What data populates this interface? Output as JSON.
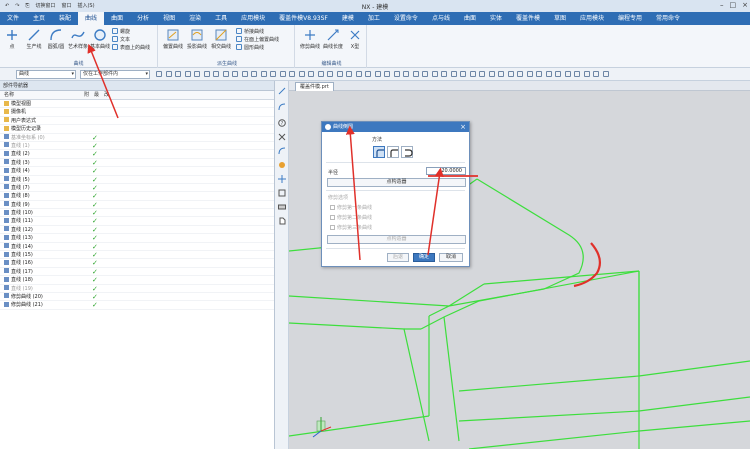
{
  "titlebar": {
    "quick_access": [
      "↶",
      "↷",
      "⎘",
      "切换窗口",
      "窗口",
      "插入(S)"
    ],
    "title": "NX - 建模"
  },
  "menu_tabs": [
    "文件",
    "主页",
    "装配",
    "曲线",
    "曲面",
    "分析",
    "视图",
    "渲染",
    "工具",
    "应用模块",
    "覆盖件模V8.93SF",
    "建模",
    "加工",
    "设置命令",
    "点与线",
    "曲面",
    "实体",
    "覆盖件模",
    "草图",
    "应用模块",
    "编程专用",
    "常用命令"
  ],
  "active_tab_index": 3,
  "ribbon": {
    "big_buttons": [
      "点",
      "生产线",
      "圆弧/圆",
      "艺术样条",
      "基本曲线"
    ],
    "small_buttons": [
      "螺旋",
      "文本",
      "表面上的曲线"
    ],
    "group_curve": "曲线",
    "derived_buttons": [
      "偏置曲线",
      "投影曲线",
      "相交曲线"
    ],
    "derived_small": [
      "桥接曲线",
      "在面上偏置曲线",
      "圆形曲线"
    ],
    "group_derived": "派生曲线",
    "edit_buttons": [
      "修剪曲线",
      "曲线长度",
      "X型"
    ],
    "group_edit": "编辑曲线"
  },
  "toolbar": {
    "combo1": "曲线",
    "combo2": "仅在工作部件内"
  },
  "navigator": {
    "header": "部件导航器",
    "columns": [
      "名称",
      "附",
      "最",
      "改"
    ],
    "rows": [
      {
        "label": "模型视图",
        "check": false,
        "grey": false
      },
      {
        "label": "摄像机",
        "check": false,
        "grey": false
      },
      {
        "label": "用户表达式",
        "check": false,
        "grey": false
      },
      {
        "label": "模型历史记录",
        "check": false,
        "grey": false
      },
      {
        "label": "基准坐标系 (0)",
        "check": true,
        "grey": true
      },
      {
        "label": "直线 (1)",
        "check": true,
        "grey": true
      },
      {
        "label": "直线 (2)",
        "check": true,
        "grey": false
      },
      {
        "label": "直线 (3)",
        "check": true,
        "grey": false
      },
      {
        "label": "直线 (4)",
        "check": true,
        "grey": false
      },
      {
        "label": "直线 (5)",
        "check": true,
        "grey": false
      },
      {
        "label": "直线 (7)",
        "check": true,
        "grey": false
      },
      {
        "label": "直线 (8)",
        "check": true,
        "grey": false
      },
      {
        "label": "直线 (9)",
        "check": true,
        "grey": false
      },
      {
        "label": "直线 (10)",
        "check": true,
        "grey": false
      },
      {
        "label": "直线 (11)",
        "check": true,
        "grey": false
      },
      {
        "label": "直线 (12)",
        "check": true,
        "grey": false
      },
      {
        "label": "直线 (13)",
        "check": true,
        "grey": false
      },
      {
        "label": "直线 (14)",
        "check": true,
        "grey": false
      },
      {
        "label": "直线 (15)",
        "check": true,
        "grey": false
      },
      {
        "label": "直线 (16)",
        "check": true,
        "grey": false
      },
      {
        "label": "直线 (17)",
        "check": true,
        "grey": false
      },
      {
        "label": "直线 (18)",
        "check": true,
        "grey": false
      },
      {
        "label": "直线 (19)",
        "check": true,
        "grey": true
      },
      {
        "label": "修剪曲线 (20)",
        "check": true,
        "grey": false
      },
      {
        "label": "修剪曲线 (21)",
        "check": true,
        "grey": false
      }
    ]
  },
  "document_tab": "覆盖件模.prt",
  "dialog": {
    "title": "曲线倒圆",
    "method_label": "方法",
    "radius_label": "半径",
    "radius_value": "20.0000",
    "point_button": "点构造器",
    "trim_label": "修剪选项",
    "trim_options": [
      "修剪第一条曲线",
      "修剪第二条曲线",
      "修剪第三条曲线"
    ],
    "select_button": "点构造器",
    "back_button": "后退",
    "ok_button": "确定",
    "cancel_button": "取消"
  },
  "colors": {
    "accent": "#2e6db4",
    "curve": "#3dde3d",
    "annotation": "#e0302a",
    "check": "#2fa52f"
  }
}
